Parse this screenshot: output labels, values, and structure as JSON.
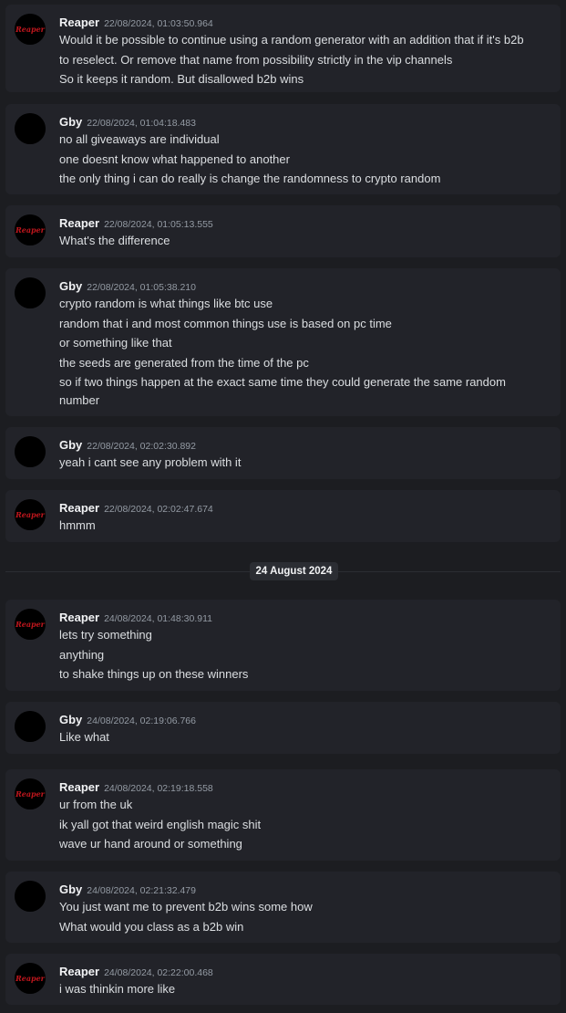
{
  "messages": [
    {
      "author": "Reaper",
      "avatar": "reaper-logo",
      "timestamp": "22/08/2024, 01:03:50.964",
      "lines": [
        "Would it be possible to continue using a random generator with an addition that if it's b2b",
        "to reselect. Or remove that name from possibility strictly in the vip channels",
        "So it keeps it random. But disallowed b2b wins"
      ]
    },
    {
      "author": "Gby",
      "avatar": "black-circle",
      "timestamp": "22/08/2024, 01:04:18.483",
      "lines": [
        "no all giveaways are individual",
        "one doesnt know what happened to another",
        "the only thing i can do really is change the randomness to crypto random"
      ]
    },
    {
      "author": "Reaper",
      "avatar": "reaper-logo",
      "timestamp": "22/08/2024, 01:05:13.555",
      "lines": [
        "What's the difference"
      ]
    },
    {
      "author": "Gby",
      "avatar": "black-circle",
      "timestamp": "22/08/2024, 01:05:38.210",
      "lines": [
        "crypto random is what things like btc use",
        "random that i and most common things use is based on pc time",
        "or something like that",
        "the seeds are generated from the time of the pc",
        "so if two things happen at the exact same time they could generate the same random",
        "number"
      ]
    },
    {
      "author": "Gby",
      "avatar": "black-circle",
      "timestamp": "22/08/2024, 02:02:30.892",
      "lines": [
        "yeah i cant see any problem with it"
      ]
    },
    {
      "author": "Reaper",
      "avatar": "reaper-logo",
      "timestamp": "22/08/2024, 02:02:47.674",
      "lines": [
        "hmmm"
      ]
    },
    {
      "author": "Reaper",
      "avatar": "reaper-logo",
      "timestamp": "24/08/2024, 01:48:30.911",
      "lines": [
        "lets try something",
        "anything",
        "to shake things up on these winners"
      ]
    },
    {
      "author": "Gby",
      "avatar": "black-circle",
      "timestamp": "24/08/2024, 02:19:06.766",
      "lines": [
        "Like what"
      ]
    },
    {
      "author": "Reaper",
      "avatar": "reaper-logo",
      "timestamp": "24/08/2024, 02:19:18.558",
      "lines": [
        "ur from the uk",
        "ik yall got that weird english magic shit",
        "wave ur hand around or something"
      ]
    },
    {
      "author": "Gby",
      "avatar": "black-circle",
      "timestamp": "24/08/2024, 02:21:32.479",
      "lines": [
        "You just want me to prevent b2b wins some how",
        "What would you class as a b2b win"
      ]
    },
    {
      "author": "Reaper",
      "avatar": "reaper-logo",
      "timestamp": "24/08/2024, 02:22:00.468",
      "lines": [
        "i was thinkin more like"
      ]
    }
  ],
  "date_separator": "24 August 2024",
  "logo_text": "Reaper",
  "colors": {
    "background": "#1c1d21",
    "card": "#222329",
    "logo_red": "#c0161d",
    "timestamp": "#949ba4"
  }
}
